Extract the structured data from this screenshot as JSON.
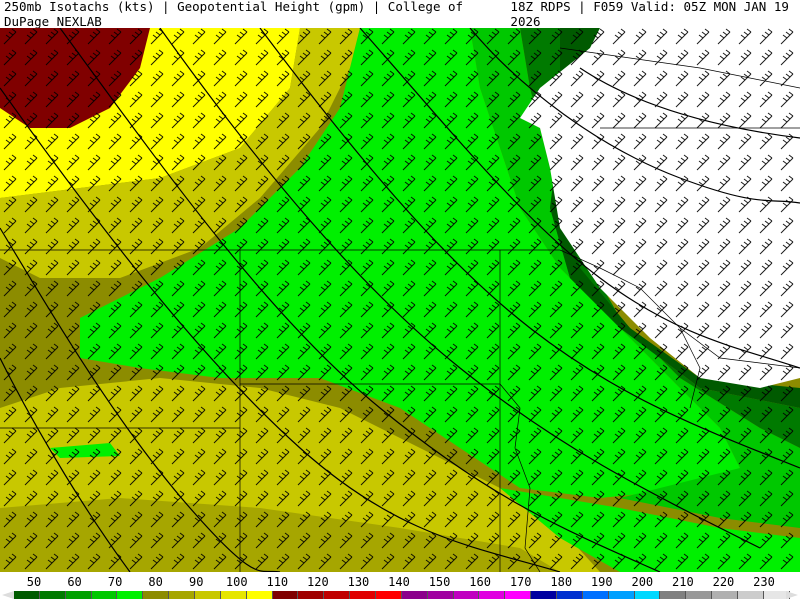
{
  "header": {
    "left": "250mb Isotachs (kts) | Geopotential Height (gpm) | College of DuPage NEXLAB",
    "right": "18Z RDPS | F059 Valid: 05Z MON JAN 19 2026"
  },
  "legend": {
    "labels": [
      "50",
      "60",
      "70",
      "80",
      "90",
      "100",
      "110",
      "120",
      "130",
      "140",
      "150",
      "160",
      "170",
      "180",
      "190",
      "200",
      "210",
      "220",
      "230"
    ],
    "colors": [
      "#005a00",
      "#007a00",
      "#00a000",
      "#00c800",
      "#00f000",
      "#8c8c00",
      "#a6a600",
      "#c8c800",
      "#e6e600",
      "#ffff00",
      "#800000",
      "#a00000",
      "#c00000",
      "#e00000",
      "#ff0000",
      "#8b008b",
      "#a000a0",
      "#c000c0",
      "#e000e0",
      "#ff00ff",
      "#0000a0",
      "#0030d0",
      "#0070ff",
      "#00a0ff",
      "#00d8ff",
      "#808080",
      "#999999",
      "#b0b0b0",
      "#cccccc",
      "#e6e6e6"
    ]
  },
  "map": {
    "isotach_colors": {
      "white": "#ffffff",
      "g50": "#005a00",
      "g60": "#007a00",
      "g70": "#00a000",
      "g80": "#00c800",
      "g90": "#00f000",
      "y100": "#8c8c00",
      "y105": "#a6a600",
      "y110": "#c8c800",
      "y115": "#e6e600",
      "y120": "#ffff00",
      "red": "#800000"
    }
  }
}
